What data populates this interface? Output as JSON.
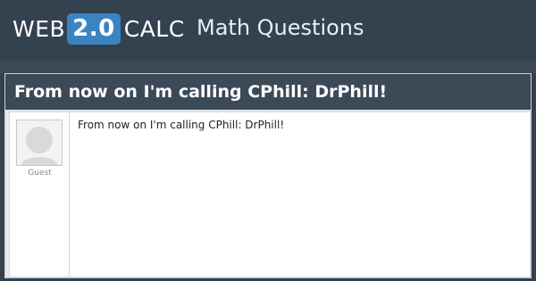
{
  "header": {
    "logo_prefix": "WEB",
    "logo_version": "2.0",
    "logo_suffix": "CALC",
    "site_title": "Math Questions"
  },
  "question": {
    "title": "From now on I'm calling CPhill: DrPhill!",
    "author": "Guest",
    "author_avatar_icon": "user-avatar-icon",
    "body": "From now on I'm calling CPhill: DrPhill!"
  },
  "colors": {
    "background": "#34414f",
    "title_bar": "#3c4a58",
    "logo_badge": "#3b84c4",
    "post_background": "#ffffff"
  }
}
